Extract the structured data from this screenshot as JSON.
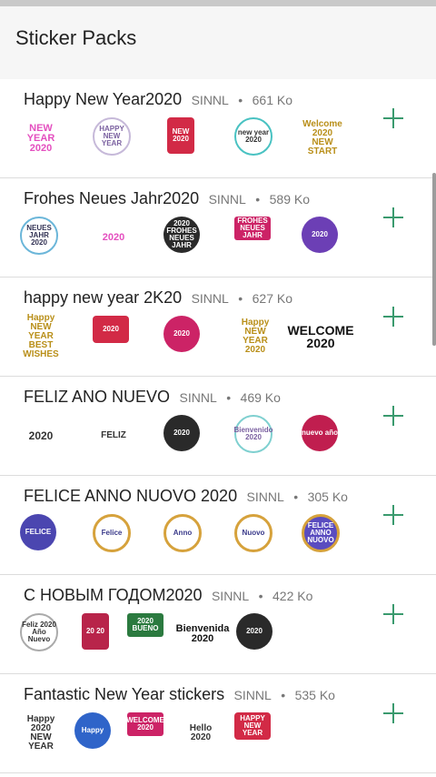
{
  "header": {
    "title": "Sticker Packs"
  },
  "packs": [
    {
      "name": "Happy New Year2020",
      "author": "SINNL",
      "size": "661 Ko",
      "stickers": [
        "NEW YEAR 2020",
        "HAPPY NEW YEAR",
        "NEW 2020",
        "new year 2020",
        "Welcome 2020 NEW START"
      ]
    },
    {
      "name": "Frohes Neues Jahr2020",
      "author": "SINNL",
      "size": "589 Ko",
      "stickers": [
        "NEUES JAHR 2020",
        "2020",
        "2020 FROHES NEUES JAHR",
        "FROHES NEUES JAHR",
        "2020"
      ]
    },
    {
      "name": "happy new year 2K20",
      "author": "SINNL",
      "size": "627 Ko",
      "stickers": [
        "Happy NEW YEAR BEST WISHES",
        "2020",
        "2020",
        "Happy NEW YEAR 2020",
        "WELCOME 2020"
      ]
    },
    {
      "name": "FELIZ ANO NUEVO",
      "author": "SINNL",
      "size": "469 Ko",
      "stickers": [
        "2020",
        "FELIZ",
        "2020",
        "Bienvenido 2020",
        "nuevo año"
      ]
    },
    {
      "name": "FELICE ANNO NUOVO 2020",
      "author": "SINNL",
      "size": "305 Ko",
      "stickers": [
        "FELICE",
        "Felice",
        "Anno",
        "Nuovo",
        "FELICE ANNO NUOVO"
      ]
    },
    {
      "name": "С НОВЫМ ГОДОМ2020",
      "author": "SINNL",
      "size": "422 Ko",
      "stickers": [
        "Feliz 2020 Año Nuevo",
        "20 20",
        "2020 BUENO",
        "Bienvenida 2020",
        "2020"
      ]
    },
    {
      "name": "Fantastic New Year stickers",
      "author": "SINNL",
      "size": "535 Ko",
      "stickers": [
        "Happy 2020 NEW YEAR",
        "Happy",
        "WELCOME 2020",
        "Hello 2020",
        "HAPPY NEW YEAR"
      ]
    }
  ],
  "colors": {
    "accent": "#3a9a6e",
    "header_bg": "#f6f6f6",
    "divider": "#dcdcdc"
  },
  "icons": {
    "add": "plus-icon"
  }
}
